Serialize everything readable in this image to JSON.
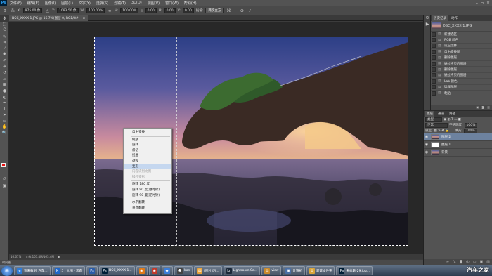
{
  "menubar": {
    "logo": "Ps",
    "items": [
      "文件(F)",
      "编辑(E)",
      "图像(I)",
      "图层(L)",
      "文字(Y)",
      "选择(S)",
      "滤镜(T)",
      "3D(D)",
      "视图(V)",
      "窗口(W)",
      "帮助(H)"
    ]
  },
  "options": {
    "x_label": "X:",
    "x_value": "975.00 像",
    "y_label": "Y:",
    "y_value": "1083.50 像",
    "w_label": "W:",
    "w_value": "100.00%",
    "h_label": "H:",
    "h_value": "100.00%",
    "angle_label": "△",
    "angle_value": "0.00",
    "hskew_label": "H:",
    "hskew_value": "0.00",
    "vskew_label": "V:",
    "vskew_value": "0.00",
    "interp_label": "插值:",
    "interp_value": "两次立方",
    "cancel": "⊘",
    "commit": "✓"
  },
  "document": {
    "tab_title": "DSC_XXXX-1.JPG @ 16.7%(图层 0, RGB/8#)",
    "zoom": "16.67%",
    "doc_info": "文档:163.4M/163.4M",
    "timeline": "时间轴"
  },
  "context_menu": {
    "items": [
      {
        "label": "自由变换",
        "state": "normal"
      },
      {
        "sep": true
      },
      {
        "label": "缩放",
        "state": "normal"
      },
      {
        "label": "旋转",
        "state": "normal"
      },
      {
        "label": "斜切",
        "state": "normal"
      },
      {
        "label": "扭曲",
        "state": "normal"
      },
      {
        "label": "透视",
        "state": "normal"
      },
      {
        "label": "变形",
        "state": "highlight"
      },
      {
        "label": "内容识别比例",
        "state": "disabled"
      },
      {
        "label": "操控变形",
        "state": "disabled"
      },
      {
        "sep": true
      },
      {
        "label": "旋转 180 度",
        "state": "normal"
      },
      {
        "label": "旋转 90 度(顺时针)",
        "state": "normal"
      },
      {
        "label": "旋转 90 度(逆时针)",
        "state": "normal"
      },
      {
        "sep": true
      },
      {
        "label": "水平翻转",
        "state": "normal"
      },
      {
        "label": "垂直翻转",
        "state": "normal"
      }
    ]
  },
  "history": {
    "tabs": [
      "历史记录",
      "动作"
    ],
    "snapshot": "DSC_XXXX-1.JPG",
    "items": [
      "新建选区",
      "RGB 颜色",
      "适应选择",
      "自由变换图",
      "删除图层",
      "通过拷贝的图层",
      "删除图层",
      "通过拷贝的图层",
      "Lab 颜色",
      "选择图层",
      "粘贴"
    ]
  },
  "layers": {
    "tabs": [
      "图层",
      "通道",
      "路径"
    ],
    "kind_label": "类型",
    "blend_mode": "正常",
    "opacity_label": "不透明度:",
    "opacity": "100%",
    "lock_label": "锁定:",
    "fill_label": "填充:",
    "fill": "100%",
    "rows": [
      {
        "name": "图层 2",
        "selected": true,
        "thumb": "photo"
      },
      {
        "name": "图层 1",
        "selected": false,
        "thumb": "white"
      },
      {
        "name": "背景",
        "selected": false,
        "thumb": "photo"
      }
    ],
    "footer_icons": [
      "link-icon",
      "fx-icon",
      "mask-icon",
      "adjust-icon",
      "folder-icon",
      "new-layer-icon",
      "trash-icon"
    ]
  },
  "taskbar": {
    "items": [
      {
        "label": "我来教制_汽车...",
        "color": "#2e7bd6",
        "glyph": "e"
      },
      {
        "label": "5 · 大图 · 黑白",
        "color": "#1e66c9",
        "glyph": "K"
      },
      {
        "label": "",
        "color": "#2a5ca8",
        "glyph": "Ps"
      },
      {
        "label": "DSC_XXXX-1...",
        "color": "#001e36",
        "glyph": "Ps"
      },
      {
        "label": "",
        "color": "#e07a18",
        "glyph": "◉"
      },
      {
        "label": "",
        "color": "#c0392b",
        "glyph": "◉"
      },
      {
        "label": "",
        "color": "#3b7dd8",
        "glyph": "◆"
      },
      {
        "label": "Iron",
        "color": "#444",
        "glyph": "☻"
      },
      {
        "label": "[图片]汽...",
        "color": "#e8a33a",
        "glyph": "▤"
      },
      {
        "label": "Lightroom Ca...",
        "color": "#1b2838",
        "glyph": "Lr"
      },
      {
        "label": "view",
        "color": "#c98a2b",
        "glyph": "▤"
      },
      {
        "label": "计算机",
        "color": "#4a6fa5",
        "glyph": "▣"
      },
      {
        "label": "新建文件夹",
        "color": "#d8a53a",
        "glyph": "▤"
      },
      {
        "label": "未标题-29.jpg...",
        "color": "#001e36",
        "glyph": "Ps"
      }
    ],
    "watermark": "汽车之家"
  },
  "colors": {
    "foreground": "#e81010",
    "background": "#ffffff"
  }
}
